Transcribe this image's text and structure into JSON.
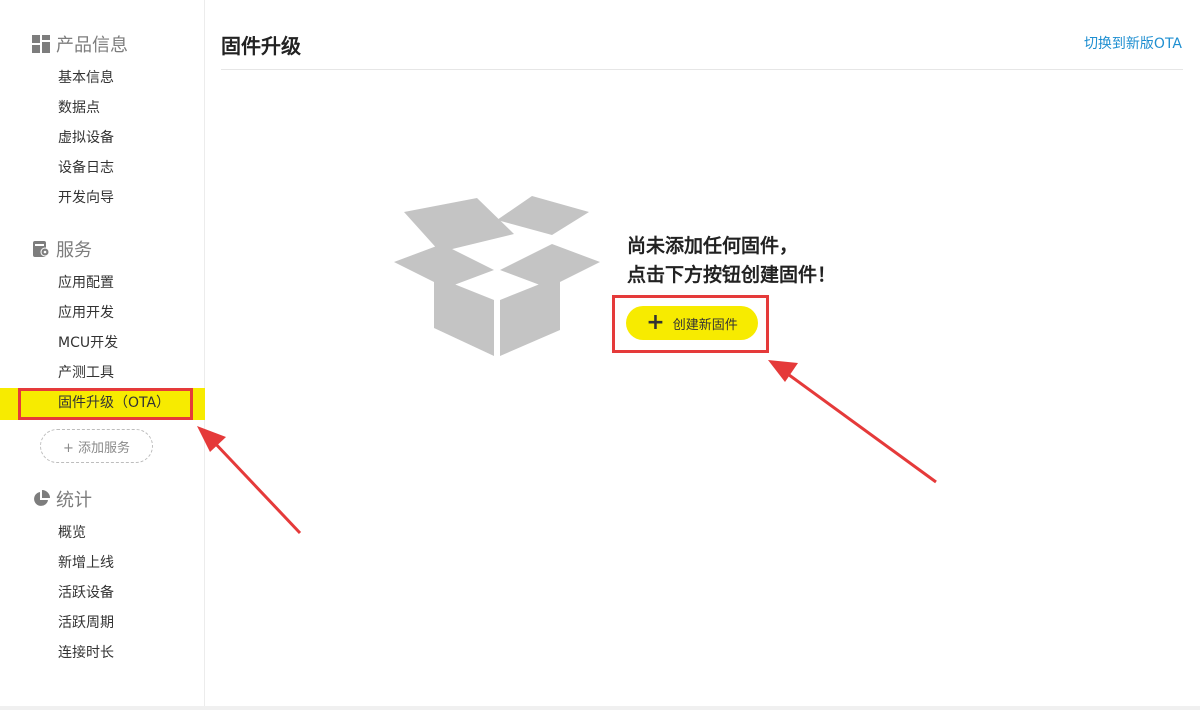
{
  "sidebar": {
    "sections": [
      {
        "title": "产品信息",
        "icon": "grid-icon",
        "items": [
          "基本信息",
          "数据点",
          "虚拟设备",
          "设备日志",
          "开发向导"
        ]
      },
      {
        "title": "服务",
        "icon": "settings-icon",
        "items": [
          "应用配置",
          "应用开发",
          "MCU开发",
          "产测工具",
          "固件升级（OTA）"
        ]
      },
      {
        "title": "统计",
        "icon": "pie-chart-icon",
        "items": [
          "概览",
          "新增上线",
          "活跃设备",
          "活跃周期",
          "连接时长"
        ]
      }
    ],
    "add_service": "+ 添加服务",
    "active_item": "固件升级（OTA）"
  },
  "main": {
    "title": "固件升级",
    "switch_link": "切换到新版OTA",
    "empty_line1": "尚未添加任何固件，",
    "empty_line2": "点击下方按钮创建固件！",
    "create_button": "创建新固件"
  },
  "colors": {
    "accent": "#f7eb00",
    "highlight": "#e53a3a",
    "link": "#1f8fd1"
  }
}
